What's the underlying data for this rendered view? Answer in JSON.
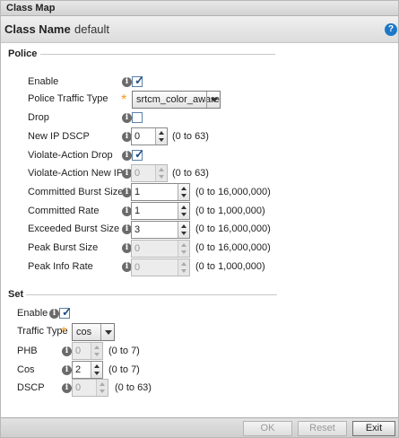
{
  "window": {
    "title": "Class Map"
  },
  "header": {
    "label": "Class Name",
    "value": "default",
    "help_icon": "?"
  },
  "police": {
    "title": "Police",
    "enable": {
      "label": "Enable",
      "checked": true
    },
    "traffic_type": {
      "label": "Police Traffic Type",
      "value": "srtcm_color_aware"
    },
    "drop": {
      "label": "Drop",
      "checked": false
    },
    "new_ip_dscp": {
      "label": "New IP DSCP",
      "value": "0",
      "range": "(0 to 63)"
    },
    "violate_drop": {
      "label": "Violate-Action Drop",
      "checked": true
    },
    "violate_dscp": {
      "label": "Violate-Action New IP DSCP",
      "value": "0",
      "range": "(0 to 63)"
    },
    "committed_burst": {
      "label": "Committed Burst Size",
      "value": "1",
      "range": "(0 to 16,000,000)"
    },
    "committed_rate": {
      "label": "Committed Rate",
      "value": "1",
      "range": "(0 to 1,000,000)"
    },
    "exceeded_burst": {
      "label": "Exceeded Burst Size",
      "value": "3",
      "range": "(0 to 16,000,000)"
    },
    "peak_burst": {
      "label": "Peak Burst Size",
      "value": "0",
      "range": "(0 to 16,000,000)"
    },
    "peak_rate": {
      "label": "Peak Info Rate",
      "value": "0",
      "range": "(0 to 1,000,000)"
    }
  },
  "set": {
    "title": "Set",
    "enable": {
      "label": "Enable",
      "checked": true
    },
    "traffic_type": {
      "label": "Traffic Type",
      "value": "cos"
    },
    "phb": {
      "label": "PHB",
      "value": "0",
      "range": "(0 to 7)"
    },
    "cos": {
      "label": "Cos",
      "value": "2",
      "range": "(0 to 7)"
    },
    "dscp": {
      "label": "DSCP",
      "value": "0",
      "range": "(0 to 63)"
    }
  },
  "footer": {
    "ok": "OK",
    "reset": "Reset",
    "exit": "Exit"
  },
  "glyphs": {
    "info": "i",
    "required": "*",
    "check": "✓"
  }
}
